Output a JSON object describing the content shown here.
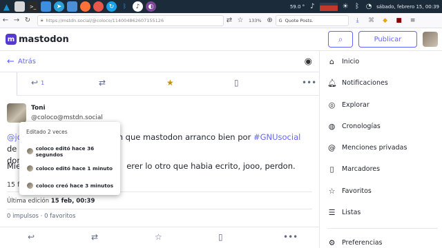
{
  "os_panel": {
    "temp": "59.0 °",
    "clock": "sábado, febrero 15, 00:39"
  },
  "browser": {
    "url": "https://mstdn.social/@coloco/114004862607155126",
    "zoom": "133%",
    "search_placeholder": "Quote Posts."
  },
  "header": {
    "logo_text": "mastodon",
    "publish_label": "Publicar"
  },
  "back": {
    "label": "Atrás"
  },
  "actions_top": {
    "reply_count": "1"
  },
  "status": {
    "display_name": "Toni",
    "account": "@coloco@mstdn.social",
    "text_prefix": "@jo",
    "text_middle": "n que mastodon arranco bien por ",
    "hashtag": "#GNUsocial",
    "text_suffix": " de",
    "text_line2": "don",
    "text2_prefix": "Mie",
    "text2_rest": "erer lo otro que habia ecrito, jooo, perdon.",
    "date_short": "15 fe",
    "edit_label": "Última edición",
    "edit_date": "15 feb, 00:39",
    "boosts": "0 impulsos",
    "favs": "0 favoritos"
  },
  "history": {
    "header": "Editado 2 veces",
    "items": [
      "coloco editó hace 36 segundos",
      "coloco editó hace 1 minuto",
      "coloco creó hace 3 minutos"
    ]
  },
  "nav": {
    "items": [
      {
        "label": "Inicio",
        "icon": "home-icon"
      },
      {
        "label": "Notificaciones",
        "icon": "bell-icon"
      },
      {
        "label": "Explorar",
        "icon": "compass-icon"
      },
      {
        "label": "Cronologías",
        "icon": "globe-icon"
      },
      {
        "label": "Menciones privadas",
        "icon": "at-icon"
      },
      {
        "label": "Marcadores",
        "icon": "bookmark-icon"
      },
      {
        "label": "Favoritos",
        "icon": "star-icon"
      },
      {
        "label": "Listas",
        "icon": "list-icon"
      },
      {
        "label": "Preferencias",
        "icon": "gear-icon"
      }
    ]
  },
  "colors": {
    "accent": "#6364ff",
    "brand": "#563acc",
    "panel": "#1c2b3a",
    "fav_star": "#ca8f04"
  }
}
